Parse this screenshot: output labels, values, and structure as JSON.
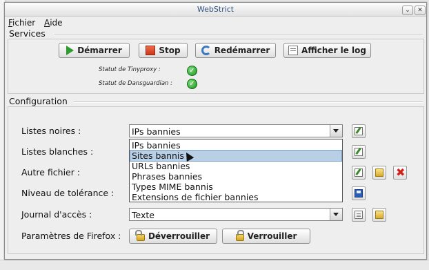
{
  "window": {
    "title": "WebStrict"
  },
  "menu": [
    {
      "mnemonic": "F",
      "rest": "ichier"
    },
    {
      "mnemonic": "A",
      "rest": "ide"
    }
  ],
  "services": {
    "label": "Services",
    "buttons": {
      "start": "Démarrer",
      "stop": "Stop",
      "restart": "Redémarrer",
      "log": "Afficher le log"
    },
    "status": [
      {
        "label": "Statut de Tinyproxy :",
        "state": "ok"
      },
      {
        "label": "Statut de Dansguardian :",
        "state": "ok"
      }
    ]
  },
  "configuration": {
    "label": "Configuration",
    "rows": {
      "blacklists": {
        "label": "Listes noires :",
        "value": "IPs bannies"
      },
      "whitelists": {
        "label": "Listes blanches :"
      },
      "other_file": {
        "label": "Autre fichier :"
      },
      "tolerance": {
        "label": "Niveau de tolérance :"
      },
      "access_log": {
        "label": "Journal d'accès :",
        "value": "Texte"
      },
      "firefox": {
        "label": "Paramètres de Firefox :",
        "unlock": "Déverrouiller",
        "lock": "Verrouiller"
      }
    },
    "dropdown_options": [
      "IPs bannies",
      "Sites bannis",
      "URLs bannies",
      "Phrases bannies",
      "Types MIME bannis",
      "Extensions de fichier bannies"
    ],
    "highlighted_option": "Sites bannis"
  },
  "colors": {
    "highlight": "#b8cfe5",
    "status_ok": "#1e8f1e",
    "delete": "#d0201a"
  }
}
